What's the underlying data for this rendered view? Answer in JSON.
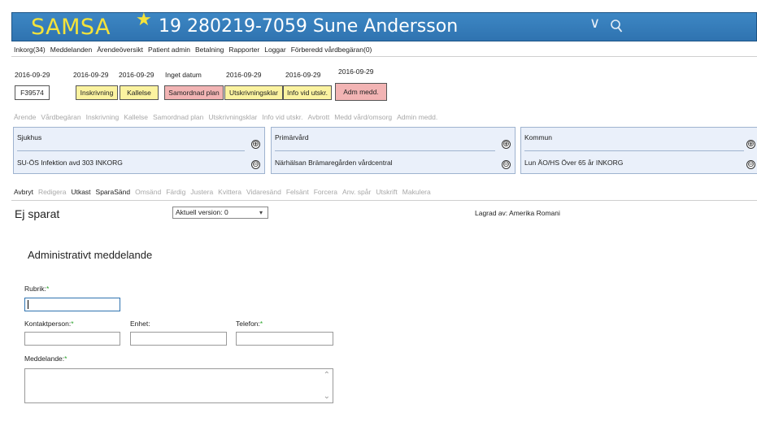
{
  "header": {
    "app_name": "SAMSA",
    "patient": "19 280219-7059 Sune Andersson",
    "star_glyph": "★",
    "chevron_glyph": "∨",
    "accent_color": "#3d87c4",
    "logo_color": "#f5e33a"
  },
  "menu": {
    "items": [
      "Inkorg(34)",
      "Meddelanden",
      "Ärendeöversikt",
      "Patient admin",
      "Betalning",
      "Rapporter",
      "Loggar",
      "Förberedd vårdbegäran(0)"
    ]
  },
  "timeline": [
    {
      "date": "2016-09-29",
      "label": "F39574",
      "style": "white"
    },
    {
      "date": "2016-09-29",
      "label": "Inskrivning",
      "style": "yellow"
    },
    {
      "date": "2016-09-29",
      "label": "Kallelse",
      "style": "yellow"
    },
    {
      "date": "Inget datum",
      "label": "Samordnad plan",
      "style": "red"
    },
    {
      "date": "2016-09-29",
      "label": "Utskrivningsklar",
      "style": "yellow"
    },
    {
      "date": "2016-09-29",
      "label": "Info vid utskr.",
      "style": "yellow"
    },
    {
      "date": "2016-09-29",
      "label": "Adm medd.",
      "style": "red"
    }
  ],
  "phases": [
    "Ärende",
    "Vårdbegäran",
    "Inskrivning",
    "Kallelse",
    "Samordnad plan",
    "Utskrivningsklar",
    "Info vid utskr.",
    "Avbrott",
    "Medd vård/omsorg",
    "Admin medd."
  ],
  "units": [
    {
      "title": "Sjukhus",
      "value": "SU-ÖS Infektion avd 303 INKORG"
    },
    {
      "title": "Primärvård",
      "value": "Närhälsan Brämaregården vårdcentral"
    },
    {
      "title": "Kommun",
      "value": "Lun ÄO/HS Över 65 år INKORG"
    }
  ],
  "actions": [
    {
      "label": "Avbryt",
      "active": true
    },
    {
      "label": "Redigera",
      "active": false
    },
    {
      "label": "Utkast",
      "active": true
    },
    {
      "label": "SparaSänd",
      "active": true
    },
    {
      "label": "Omsänd",
      "active": false
    },
    {
      "label": "Färdig",
      "active": false
    },
    {
      "label": "Justera",
      "active": false
    },
    {
      "label": "Kvittera",
      "active": false
    },
    {
      "label": "Vidaresänd",
      "active": false
    },
    {
      "label": "Felsänt",
      "active": false
    },
    {
      "label": "Forcera",
      "active": false
    },
    {
      "label": "Anv. spår",
      "active": false
    },
    {
      "label": "Utskrift",
      "active": false
    },
    {
      "label": "Makulera",
      "active": false
    }
  ],
  "status": {
    "state": "Ej sparat",
    "version_selected": "Aktuell version: 0",
    "saved_by": "Lagrad av: Amerika Romani"
  },
  "form": {
    "title": "Administrativt meddelande",
    "rubrik_label": "Rubrik:",
    "kontaktperson_label": "Kontaktperson:",
    "enhet_label": "Enhet:",
    "telefon_label": "Telefon:",
    "meddelande_label": "Meddelande:",
    "required_mark": "*",
    "rubrik_value": "",
    "kontaktperson_value": "",
    "enhet_value": "",
    "telefon_value": "",
    "meddelande_value": ""
  },
  "icons": {
    "plus": "⊕",
    "minus": "⊖",
    "scroll_up": "⌃",
    "scroll_down": "⌄",
    "dropdown_caret": "▾"
  }
}
